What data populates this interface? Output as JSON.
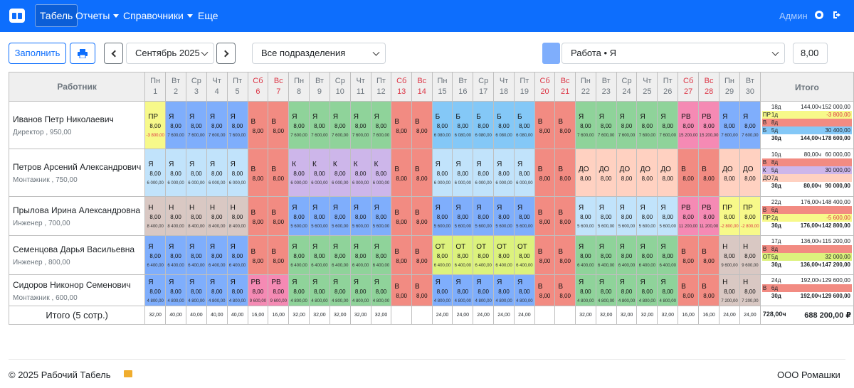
{
  "nav": {
    "brand_icon": "calendar-icon",
    "items": [
      {
        "label": "Табель"
      },
      {
        "label": "Отчеты"
      },
      {
        "label": "Справочники"
      },
      {
        "label": "Еще"
      }
    ],
    "user": "Админ"
  },
  "toolbar": {
    "fill_label": "Заполнить",
    "month": "Сентябрь 2025",
    "department": "Все подразделения",
    "mark": "Работа • Я",
    "mark_color": "#7faefc",
    "hours": "8,00"
  },
  "table": {
    "worker_header": "Работник",
    "total_header": "Итого",
    "days": [
      {
        "d": "1",
        "w": "Пн"
      },
      {
        "d": "2",
        "w": "Вт"
      },
      {
        "d": "3",
        "w": "Ср"
      },
      {
        "d": "4",
        "w": "Чт"
      },
      {
        "d": "5",
        "w": "Пт"
      },
      {
        "d": "6",
        "w": "Сб"
      },
      {
        "d": "7",
        "w": "Вс"
      },
      {
        "d": "8",
        "w": "Пн"
      },
      {
        "d": "9",
        "w": "Вт"
      },
      {
        "d": "10",
        "w": "Ср"
      },
      {
        "d": "11",
        "w": "Чт"
      },
      {
        "d": "12",
        "w": "Пт"
      },
      {
        "d": "13",
        "w": "Сб"
      },
      {
        "d": "14",
        "w": "Вс"
      },
      {
        "d": "15",
        "w": "Пн"
      },
      {
        "d": "16",
        "w": "Вт"
      },
      {
        "d": "17",
        "w": "Ср"
      },
      {
        "d": "18",
        "w": "Чт"
      },
      {
        "d": "19",
        "w": "Пт"
      },
      {
        "d": "20",
        "w": "Сб"
      },
      {
        "d": "21",
        "w": "Вс"
      },
      {
        "d": "22",
        "w": "Пн"
      },
      {
        "d": "23",
        "w": "Вт"
      },
      {
        "d": "24",
        "w": "Ср"
      },
      {
        "d": "25",
        "w": "Чт"
      },
      {
        "d": "26",
        "w": "Пт"
      },
      {
        "d": "27",
        "w": "Сб"
      },
      {
        "d": "28",
        "w": "Вс"
      },
      {
        "d": "29",
        "w": "Пн"
      },
      {
        "d": "30",
        "w": "Вт"
      }
    ],
    "employees": [
      {
        "name": "Иванов Петр Николаевич",
        "position": "Директор , 950,00",
        "cells": [
          [
            "ПР",
            "8,00",
            "-3 800,00"
          ],
          [
            "Я",
            "8,00",
            "7 600,00"
          ],
          [
            "Я",
            "8,00",
            "7 600,00"
          ],
          [
            "Я",
            "8,00",
            "7 600,00"
          ],
          [
            "Я",
            "8,00",
            "7 600,00"
          ],
          [
            "В",
            "8,00",
            ""
          ],
          [
            "В",
            "8,00",
            ""
          ],
          [
            "Я",
            "8,00",
            "7 600,00"
          ],
          [
            "Я",
            "8,00",
            "7 600,00"
          ],
          [
            "Я",
            "8,00",
            "7 600,00"
          ],
          [
            "Я",
            "8,00",
            "7 600,00"
          ],
          [
            "Я",
            "8,00",
            "7 600,00"
          ],
          [
            "В",
            "8,00",
            ""
          ],
          [
            "В",
            "8,00",
            ""
          ],
          [
            "Б",
            "8,00",
            "6 080,00"
          ],
          [
            "Б",
            "8,00",
            "6 080,00"
          ],
          [
            "Б",
            "8,00",
            "6 080,00"
          ],
          [
            "Б",
            "8,00",
            "6 080,00"
          ],
          [
            "Б",
            "8,00",
            "6 080,00"
          ],
          [
            "В",
            "8,00",
            ""
          ],
          [
            "В",
            "8,00",
            ""
          ],
          [
            "Я",
            "8,00",
            "7 600,00"
          ],
          [
            "Я",
            "8,00",
            "7 600,00"
          ],
          [
            "Я",
            "8,00",
            "7 600,00"
          ],
          [
            "Я",
            "8,00",
            "7 600,00"
          ],
          [
            "Я",
            "8,00",
            "7 600,00"
          ],
          [
            "РВ",
            "8,00",
            "15 200,00"
          ],
          [
            "РВ",
            "8,00",
            "15 200,00"
          ],
          [
            "Я",
            "8,00",
            "7 600,00"
          ],
          [
            "Я",
            "8,00",
            "7 600,00"
          ]
        ],
        "totals": [
          [
            "",
            "18д",
            "144,00ч",
            "152 000,00"
          ],
          [
            "ПР",
            "1д",
            "",
            "-3 800,00"
          ],
          [
            "В",
            "8д",
            "",
            ""
          ],
          [
            "Б",
            "5д",
            "",
            "30 400,00"
          ],
          [
            "",
            "30д",
            "144,00ч",
            "178 600,00"
          ]
        ]
      },
      {
        "name": "Петров Арсений Александрович",
        "position": "Монтажник , 750,00",
        "cells": [
          [
            "Я",
            "8,00",
            "6 000,00"
          ],
          [
            "Я",
            "8,00",
            "6 000,00"
          ],
          [
            "Я",
            "8,00",
            "6 000,00"
          ],
          [
            "Я",
            "8,00",
            "6 000,00"
          ],
          [
            "Я",
            "8,00",
            "6 000,00"
          ],
          [
            "В",
            "8,00",
            ""
          ],
          [
            "В",
            "8,00",
            ""
          ],
          [
            "К",
            "8,00",
            "6 000,00"
          ],
          [
            "К",
            "8,00",
            "6 000,00"
          ],
          [
            "К",
            "8,00",
            "6 000,00"
          ],
          [
            "К",
            "8,00",
            "6 000,00"
          ],
          [
            "К",
            "8,00",
            "6 000,00"
          ],
          [
            "В",
            "8,00",
            ""
          ],
          [
            "В",
            "8,00",
            ""
          ],
          [
            "Я",
            "8,00",
            "6 000,00"
          ],
          [
            "Я",
            "8,00",
            "6 000,00"
          ],
          [
            "Я",
            "8,00",
            "6 000,00"
          ],
          [
            "Я",
            "8,00",
            "6 000,00"
          ],
          [
            "Я",
            "8,00",
            "6 000,00"
          ],
          [
            "В",
            "8,00",
            ""
          ],
          [
            "В",
            "8,00",
            ""
          ],
          [
            "ДО",
            "8,00",
            ""
          ],
          [
            "ДО",
            "8,00",
            ""
          ],
          [
            "ДО",
            "8,00",
            ""
          ],
          [
            "ДО",
            "8,00",
            ""
          ],
          [
            "ДО",
            "8,00",
            ""
          ],
          [
            "В",
            "8,00",
            ""
          ],
          [
            "В",
            "8,00",
            ""
          ],
          [
            "ДО",
            "8,00",
            ""
          ],
          [
            "ДО",
            "8,00",
            ""
          ]
        ],
        "totals": [
          [
            "",
            "10д",
            "80,00ч",
            "60 000,00"
          ],
          [
            "В",
            "8д",
            "",
            ""
          ],
          [
            "К",
            "5д",
            "",
            "30 000,00"
          ],
          [
            "ДО",
            "7д",
            "",
            ""
          ],
          [
            "",
            "30д",
            "80,00ч",
            "90 000,00"
          ]
        ]
      },
      {
        "name": "Прылова Ирина Александровна",
        "position": "Инженер , 700,00",
        "cells": [
          [
            "Н",
            "8,00",
            "8 400,00"
          ],
          [
            "Н",
            "8,00",
            "8 400,00"
          ],
          [
            "Н",
            "8,00",
            "8 400,00"
          ],
          [
            "Н",
            "8,00",
            "8 400,00"
          ],
          [
            "Н",
            "8,00",
            "8 400,00"
          ],
          [
            "В",
            "8,00",
            ""
          ],
          [
            "В",
            "8,00",
            ""
          ],
          [
            "Я",
            "8,00",
            "5 600,00"
          ],
          [
            "Я",
            "8,00",
            "5 600,00"
          ],
          [
            "Я",
            "8,00",
            "5 600,00"
          ],
          [
            "Я",
            "8,00",
            "5 600,00"
          ],
          [
            "Я",
            "8,00",
            "5 600,00"
          ],
          [
            "В",
            "8,00",
            ""
          ],
          [
            "В",
            "8,00",
            ""
          ],
          [
            "Я",
            "8,00",
            "5 600,00"
          ],
          [
            "Я",
            "8,00",
            "5 600,00"
          ],
          [
            "Я",
            "8,00",
            "5 600,00"
          ],
          [
            "Я",
            "8,00",
            "5 600,00"
          ],
          [
            "Я",
            "8,00",
            "5 600,00"
          ],
          [
            "В",
            "8,00",
            ""
          ],
          [
            "В",
            "8,00",
            ""
          ],
          [
            "Я",
            "8,00",
            "5 600,00"
          ],
          [
            "Я",
            "8,00",
            "5 600,00"
          ],
          [
            "Я",
            "8,00",
            "5 600,00"
          ],
          [
            "Я",
            "8,00",
            "5 600,00"
          ],
          [
            "Я",
            "8,00",
            "5 600,00"
          ],
          [
            "РВ",
            "8,00",
            "11 200,00"
          ],
          [
            "РВ",
            "8,00",
            "11 200,00"
          ],
          [
            "ПР",
            "8,00",
            "-2 800,00"
          ],
          [
            "ПР",
            "8,00",
            "-2 800,00"
          ]
        ],
        "totals": [
          [
            "",
            "22д",
            "176,00ч",
            "148 400,00"
          ],
          [
            "В",
            "6д",
            "",
            ""
          ],
          [
            "ПР",
            "2д",
            "",
            "-5 600,00"
          ],
          [
            "",
            "30д",
            "176,00ч",
            "142 800,00"
          ]
        ]
      },
      {
        "name": "Семенцова Дарья Васильевна",
        "position": "Инженер , 800,00",
        "cells": [
          [
            "Я",
            "8,00",
            "6 400,00"
          ],
          [
            "Я",
            "8,00",
            "6 400,00"
          ],
          [
            "Я",
            "8,00",
            "6 400,00"
          ],
          [
            "Я",
            "8,00",
            "6 400,00"
          ],
          [
            "Я",
            "8,00",
            "6 400,00"
          ],
          [
            "В",
            "8,00",
            ""
          ],
          [
            "В",
            "8,00",
            ""
          ],
          [
            "Я",
            "8,00",
            "6 400,00"
          ],
          [
            "Я",
            "8,00",
            "6 400,00"
          ],
          [
            "Я",
            "8,00",
            "6 400,00"
          ],
          [
            "Я",
            "8,00",
            "6 400,00"
          ],
          [
            "Я",
            "8,00",
            "6 400,00"
          ],
          [
            "В",
            "8,00",
            ""
          ],
          [
            "В",
            "8,00",
            ""
          ],
          [
            "ОТ",
            "8,00",
            "6 400,00"
          ],
          [
            "ОТ",
            "8,00",
            "6 400,00"
          ],
          [
            "ОТ",
            "8,00",
            "6 400,00"
          ],
          [
            "ОТ",
            "8,00",
            "6 400,00"
          ],
          [
            "ОТ",
            "8,00",
            "6 400,00"
          ],
          [
            "В",
            "8,00",
            ""
          ],
          [
            "В",
            "8,00",
            ""
          ],
          [
            "Я",
            "8,00",
            "6 400,00"
          ],
          [
            "Я",
            "8,00",
            "6 400,00"
          ],
          [
            "Я",
            "8,00",
            "6 400,00"
          ],
          [
            "Я",
            "8,00",
            "6 400,00"
          ],
          [
            "Я",
            "8,00",
            "6 400,00"
          ],
          [
            "В",
            "8,00",
            ""
          ],
          [
            "В",
            "8,00",
            ""
          ],
          [
            "Н",
            "8,00",
            "9 600,00"
          ],
          [
            "Н",
            "8,00",
            "9 600,00"
          ]
        ],
        "totals": [
          [
            "",
            "17д",
            "136,00ч",
            "115 200,00"
          ],
          [
            "В",
            "8д",
            "",
            ""
          ],
          [
            "ОТ",
            "5д",
            "",
            "32 000,00"
          ],
          [
            "",
            "30д",
            "136,00ч",
            "147 200,00"
          ]
        ]
      },
      {
        "name": "Сидоров Никонор Семенович",
        "position": "Монтажник , 600,00",
        "cells": [
          [
            "Я",
            "8,00",
            "4 800,00"
          ],
          [
            "Я",
            "8,00",
            "4 800,00"
          ],
          [
            "Я",
            "8,00",
            "4 800,00"
          ],
          [
            "Я",
            "8,00",
            "4 800,00"
          ],
          [
            "Я",
            "8,00",
            "4 800,00"
          ],
          [
            "РВ",
            "8,00",
            "9 600,00"
          ],
          [
            "РВ",
            "8,00",
            "9 600,00"
          ],
          [
            "Я",
            "8,00",
            "4 800,00"
          ],
          [
            "Я",
            "8,00",
            "4 800,00"
          ],
          [
            "Я",
            "8,00",
            "4 800,00"
          ],
          [
            "Я",
            "8,00",
            "4 800,00"
          ],
          [
            "Я",
            "8,00",
            "4 800,00"
          ],
          [
            "В",
            "8,00",
            ""
          ],
          [
            "В",
            "8,00",
            ""
          ],
          [
            "Я",
            "8,00",
            "4 800,00"
          ],
          [
            "Я",
            "8,00",
            "4 800,00"
          ],
          [
            "Я",
            "8,00",
            "4 800,00"
          ],
          [
            "Я",
            "8,00",
            "4 800,00"
          ],
          [
            "Я",
            "8,00",
            "4 800,00"
          ],
          [
            "В",
            "8,00",
            ""
          ],
          [
            "В",
            "8,00",
            ""
          ],
          [
            "Я",
            "8,00",
            "4 800,00"
          ],
          [
            "Я",
            "8,00",
            "4 800,00"
          ],
          [
            "Я",
            "8,00",
            "4 800,00"
          ],
          [
            "Я",
            "8,00",
            "4 800,00"
          ],
          [
            "Я",
            "8,00",
            "4 800,00"
          ],
          [
            "В",
            "8,00",
            ""
          ],
          [
            "В",
            "8,00",
            ""
          ],
          [
            "Н",
            "8,00",
            "7 200,00"
          ],
          [
            "Н",
            "8,00",
            "7 200,00"
          ]
        ],
        "totals": [
          [
            "",
            "24д",
            "192,00ч",
            "129 600,00"
          ],
          [
            "В",
            "6д",
            "",
            ""
          ],
          [
            "",
            "30д",
            "192,00ч",
            "129 600,00"
          ]
        ]
      }
    ],
    "summary": {
      "label": "Итого (5 сотр.)",
      "days": [
        "32,00",
        "40,00",
        "40,00",
        "40,00",
        "40,00",
        "16,00",
        "16,00",
        "32,00",
        "32,00",
        "32,00",
        "32,00",
        "32,00",
        "",
        "",
        "24,00",
        "24,00",
        "24,00",
        "24,00",
        "24,00",
        "",
        "",
        "32,00",
        "32,00",
        "32,00",
        "32,00",
        "32,00",
        "16,00",
        "16,00",
        "24,00",
        "24,00"
      ],
      "hours": "728,00ч",
      "amount": "688 200,00 ₽"
    },
    "colors": {
      "Я": "#7faefc",
      "В": "#f28b82",
      "ПР": "#f7f98a",
      "Б": "#84c8f7",
      "РВ": "#f58ab4",
      "К": "#cdb6ea",
      "ДО": "#ffd1c1",
      "Н": "#d9c8c3",
      "ОТ": "#dcf27d",
      "green": "#8fd39a",
      "lightblue": "#c1e3fb"
    }
  },
  "footer": {
    "copyright": "© 2025 Рабочий Табель",
    "company": "ООО Ромашки",
    "mail_icon": "envelope-icon"
  }
}
